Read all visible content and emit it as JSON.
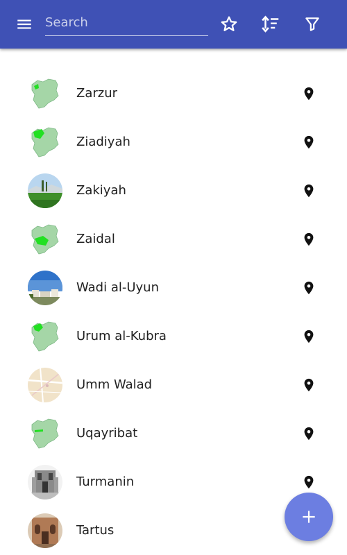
{
  "toolbar": {
    "search_placeholder": "Search",
    "menu_icon": "hamburger-menu-icon",
    "favorite_icon": "star-outline-icon",
    "sort_icon": "sort-icon",
    "filter_icon": "filter-icon",
    "background_color": "#3f51b5"
  },
  "places": [
    {
      "name": "Zarzur",
      "thumb": "map-syria-highlight-northwest"
    },
    {
      "name": "Ziadiyah",
      "thumb": "map-syria-highlight-west"
    },
    {
      "name": "Zakiyah",
      "thumb": "photo-landscape"
    },
    {
      "name": "Zaidal",
      "thumb": "map-syria-highlight-center"
    },
    {
      "name": "Wadi al-Uyun",
      "thumb": "photo-town"
    },
    {
      "name": "Urum al-Kubra",
      "thumb": "map-syria-highlight-west"
    },
    {
      "name": "Umm Walad",
      "thumb": "street-map"
    },
    {
      "name": "Uqayribat",
      "thumb": "map-syria-highlight-center-line"
    },
    {
      "name": "Turmanin",
      "thumb": "photo-ruins"
    },
    {
      "name": "Tartus",
      "thumb": "photo-church"
    }
  ],
  "row_action_icon": "location-pin-icon",
  "fab": {
    "icon": "plus-icon",
    "color": "#6c7ee1"
  }
}
